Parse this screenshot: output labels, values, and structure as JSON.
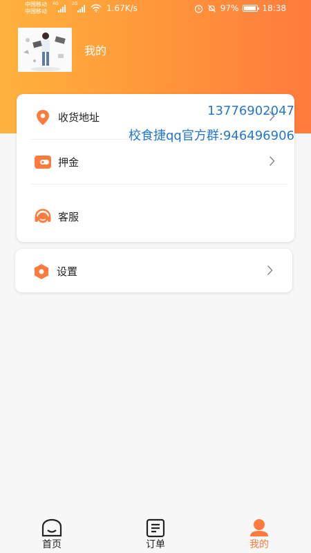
{
  "status_bar": {
    "carrier1": "中国移动",
    "carrier2": "中国移动",
    "net1": "4G",
    "net2": "2G",
    "speed": "1.67K/s",
    "battery": "97%",
    "time": "18:38"
  },
  "profile": {
    "title": "我的",
    "avatar_icon": "illustration-avatar"
  },
  "menu": {
    "address": {
      "label": "收货地址",
      "icon": "location-pin-icon"
    },
    "deposit": {
      "label": "押金",
      "icon": "wallet-icon"
    },
    "service": {
      "label": "客服",
      "icon": "headset-icon",
      "phone": "13776902047",
      "qq": "校食捷qq官方群:946496906"
    },
    "settings": {
      "label": "设置",
      "icon": "hexagon-settings-icon"
    }
  },
  "tabbar": {
    "home": "首页",
    "orders": "订单",
    "me": "我的"
  },
  "colors": {
    "accent": "#ff7a3d",
    "header_start": "#ffb23d",
    "link": "#2477cc"
  }
}
